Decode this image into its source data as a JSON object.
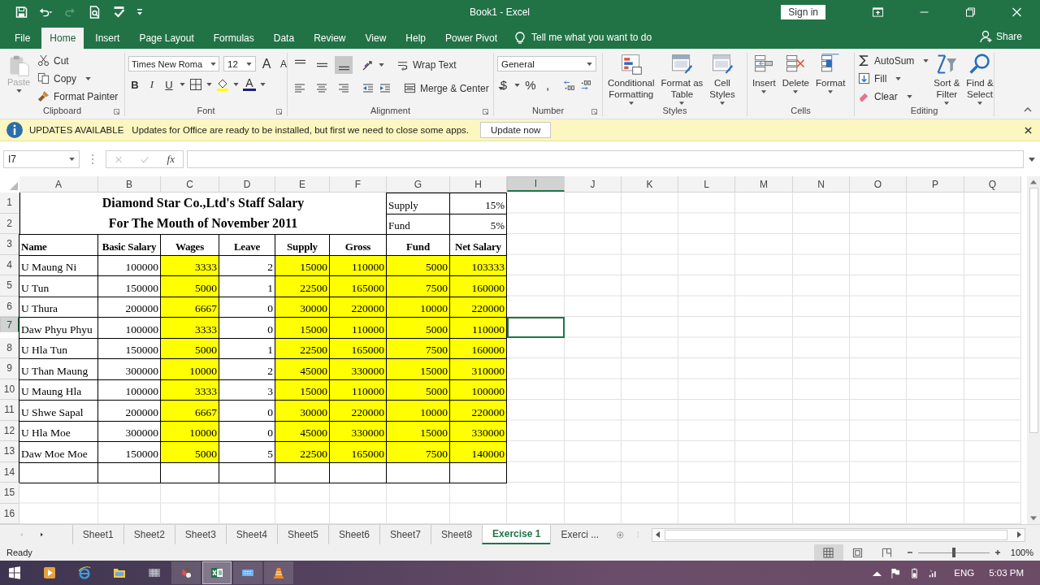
{
  "title_bar": {
    "title": "Book1  -  Excel",
    "sign_in": "Sign in"
  },
  "ribbon_tabs": [
    {
      "label": "File",
      "selected": false
    },
    {
      "label": "Home",
      "selected": true
    },
    {
      "label": "Insert",
      "selected": false
    },
    {
      "label": "Page Layout",
      "selected": false
    },
    {
      "label": "Formulas",
      "selected": false
    },
    {
      "label": "Data",
      "selected": false
    },
    {
      "label": "Review",
      "selected": false
    },
    {
      "label": "View",
      "selected": false
    },
    {
      "label": "Help",
      "selected": false
    },
    {
      "label": "Power Pivot",
      "selected": false
    }
  ],
  "tell_me": "Tell me what you want to do",
  "share": "Share",
  "clipboard": {
    "label": "Clipboard",
    "paste": "Paste",
    "paste_disabled": true,
    "cut": "Cut",
    "copy": "Copy",
    "format_painter": "Format Painter"
  },
  "font": {
    "label": "Font",
    "name": "Times New Roma",
    "size": "12",
    "grow": "A",
    "shrink": "A",
    "bold": "B",
    "italic": "I",
    "underline": "U",
    "color_letter": "A"
  },
  "alignment": {
    "label": "Alignment",
    "vertical": [
      {
        "selected": false
      },
      {
        "selected": false
      },
      {
        "selected": true
      }
    ],
    "wrap_text": "Wrap Text",
    "merge": "Merge & Center"
  },
  "number": {
    "label": "Number",
    "format": "General",
    "currency": "$",
    "percent": "%",
    "comma": ","
  },
  "styles": {
    "label": "Styles",
    "buttons": [
      "Conditional\nFormatting",
      "Format as\nTable",
      "Cell\nStyles"
    ]
  },
  "cells": {
    "label": "Cells",
    "buttons": [
      "Insert",
      "Delete",
      "Format"
    ]
  },
  "editing": {
    "label": "Editing",
    "autosum": "AutoSum",
    "fill": "Fill",
    "clear": "Clear",
    "sort": "Sort &\nFilter",
    "find": "Find &\nSelect"
  },
  "update_bar": {
    "title": "UPDATES AVAILABLE",
    "message": "Updates for Office are ready to be installed, but first we need to close some apps.",
    "button": "Update now"
  },
  "formula_bar": {
    "name_box": "I7",
    "fx": "fx"
  },
  "sheet": {
    "columns": [
      {
        "label": "A",
        "selected": false
      },
      {
        "label": "B",
        "selected": false
      },
      {
        "label": "C",
        "selected": false
      },
      {
        "label": "D",
        "selected": false
      },
      {
        "label": "E",
        "selected": false
      },
      {
        "label": "F",
        "selected": false
      },
      {
        "label": "G",
        "selected": false
      },
      {
        "label": "H",
        "selected": false
      },
      {
        "label": "I",
        "selected": true
      },
      {
        "label": "J",
        "selected": false
      },
      {
        "label": "K",
        "selected": false
      },
      {
        "label": "L",
        "selected": false
      },
      {
        "label": "M",
        "selected": false
      },
      {
        "label": "N",
        "selected": false
      },
      {
        "label": "O",
        "selected": false
      },
      {
        "label": "P",
        "selected": false
      },
      {
        "label": "Q",
        "selected": false
      }
    ],
    "rows": [
      {
        "label": "1",
        "selected": false,
        "kind": "title",
        "title": "Diamond Star Co.,Ltd's Staff Salary",
        "cells": [
          "Supply",
          "15%"
        ]
      },
      {
        "label": "2",
        "selected": false,
        "kind": "title",
        "title": "For The Mouth of November 2011",
        "cells": [
          "Fund",
          "5%"
        ]
      },
      {
        "label": "3",
        "selected": false,
        "kind": "header",
        "cells": [
          "Name",
          "Basic Salary",
          "Wages",
          "Leave",
          "Supply",
          "Gross",
          "Fund",
          "Net Salary"
        ]
      },
      {
        "label": "4",
        "selected": false,
        "kind": "data",
        "cells": [
          "U Maung Ni",
          "100000",
          "3333",
          "2",
          "15000",
          "110000",
          "5000",
          "103333"
        ],
        "highlight": [
          false,
          false,
          true,
          false,
          true,
          true,
          true,
          true
        ]
      },
      {
        "label": "5",
        "selected": false,
        "kind": "data",
        "cells": [
          "U Tun",
          "150000",
          "5000",
          "1",
          "22500",
          "165000",
          "7500",
          "160000"
        ],
        "highlight": [
          false,
          false,
          true,
          false,
          true,
          true,
          true,
          true
        ]
      },
      {
        "label": "6",
        "selected": false,
        "kind": "data",
        "cells": [
          "U Thura",
          "200000",
          "6667",
          "0",
          "30000",
          "220000",
          "10000",
          "220000"
        ],
        "highlight": [
          false,
          false,
          true,
          false,
          true,
          true,
          true,
          true
        ]
      },
      {
        "label": "7",
        "selected": true,
        "kind": "data",
        "cells": [
          "Daw Phyu Phyu",
          "100000",
          "3333",
          "0",
          "15000",
          "110000",
          "5000",
          "110000"
        ],
        "highlight": [
          false,
          false,
          true,
          false,
          true,
          true,
          true,
          true
        ]
      },
      {
        "label": "8",
        "selected": false,
        "kind": "data",
        "cells": [
          "U Hla Tun",
          "150000",
          "5000",
          "1",
          "22500",
          "165000",
          "7500",
          "160000"
        ],
        "highlight": [
          false,
          false,
          true,
          false,
          true,
          true,
          true,
          true
        ]
      },
      {
        "label": "9",
        "selected": false,
        "kind": "data",
        "cells": [
          "U Than Maung",
          "300000",
          "10000",
          "2",
          "45000",
          "330000",
          "15000",
          "310000"
        ],
        "highlight": [
          false,
          false,
          true,
          false,
          true,
          true,
          true,
          true
        ]
      },
      {
        "label": "10",
        "selected": false,
        "kind": "data",
        "cells": [
          "U Maung Hla",
          "100000",
          "3333",
          "3",
          "15000",
          "110000",
          "5000",
          "100000"
        ],
        "highlight": [
          false,
          false,
          true,
          false,
          true,
          true,
          true,
          true
        ]
      },
      {
        "label": "11",
        "selected": false,
        "kind": "data",
        "cells": [
          "U Shwe Sapal",
          "200000",
          "6667",
          "0",
          "30000",
          "220000",
          "10000",
          "220000"
        ],
        "highlight": [
          false,
          false,
          true,
          false,
          true,
          true,
          true,
          true
        ]
      },
      {
        "label": "12",
        "selected": false,
        "kind": "data",
        "cells": [
          "U Hla Moe",
          "300000",
          "10000",
          "0",
          "45000",
          "330000",
          "15000",
          "330000"
        ],
        "highlight": [
          false,
          false,
          true,
          false,
          true,
          true,
          true,
          true
        ]
      },
      {
        "label": "13",
        "selected": false,
        "kind": "data",
        "cells": [
          "Daw Moe Moe",
          "150000",
          "5000",
          "5",
          "22500",
          "165000",
          "7500",
          "140000"
        ],
        "highlight": [
          false,
          false,
          true,
          false,
          true,
          true,
          true,
          true
        ]
      },
      {
        "label": "14",
        "selected": false,
        "kind": "blank"
      },
      {
        "label": "15",
        "selected": false,
        "kind": "empty"
      },
      {
        "label": "16",
        "selected": false,
        "kind": "empty"
      }
    ]
  },
  "sheet_tabs": [
    {
      "label": "Sheet1",
      "selected": false
    },
    {
      "label": "Sheet2",
      "selected": false
    },
    {
      "label": "Sheet3",
      "selected": false
    },
    {
      "label": "Sheet4",
      "selected": false
    },
    {
      "label": "Sheet5",
      "selected": false
    },
    {
      "label": "Sheet6",
      "selected": false
    },
    {
      "label": "Sheet7",
      "selected": false
    },
    {
      "label": "Sheet8",
      "selected": false
    },
    {
      "label": "Exercise 1",
      "selected": true
    },
    {
      "label": "Exerci ...",
      "selected": false
    }
  ],
  "status_bar": {
    "status": "Ready",
    "views": [
      {
        "selected": true
      },
      {
        "selected": false
      },
      {
        "selected": false
      }
    ],
    "zoom": {
      "level": 0.5
    },
    "zoom_label": "100%"
  },
  "taskbar": {
    "language": "ENG",
    "time": "5:03 PM"
  }
}
